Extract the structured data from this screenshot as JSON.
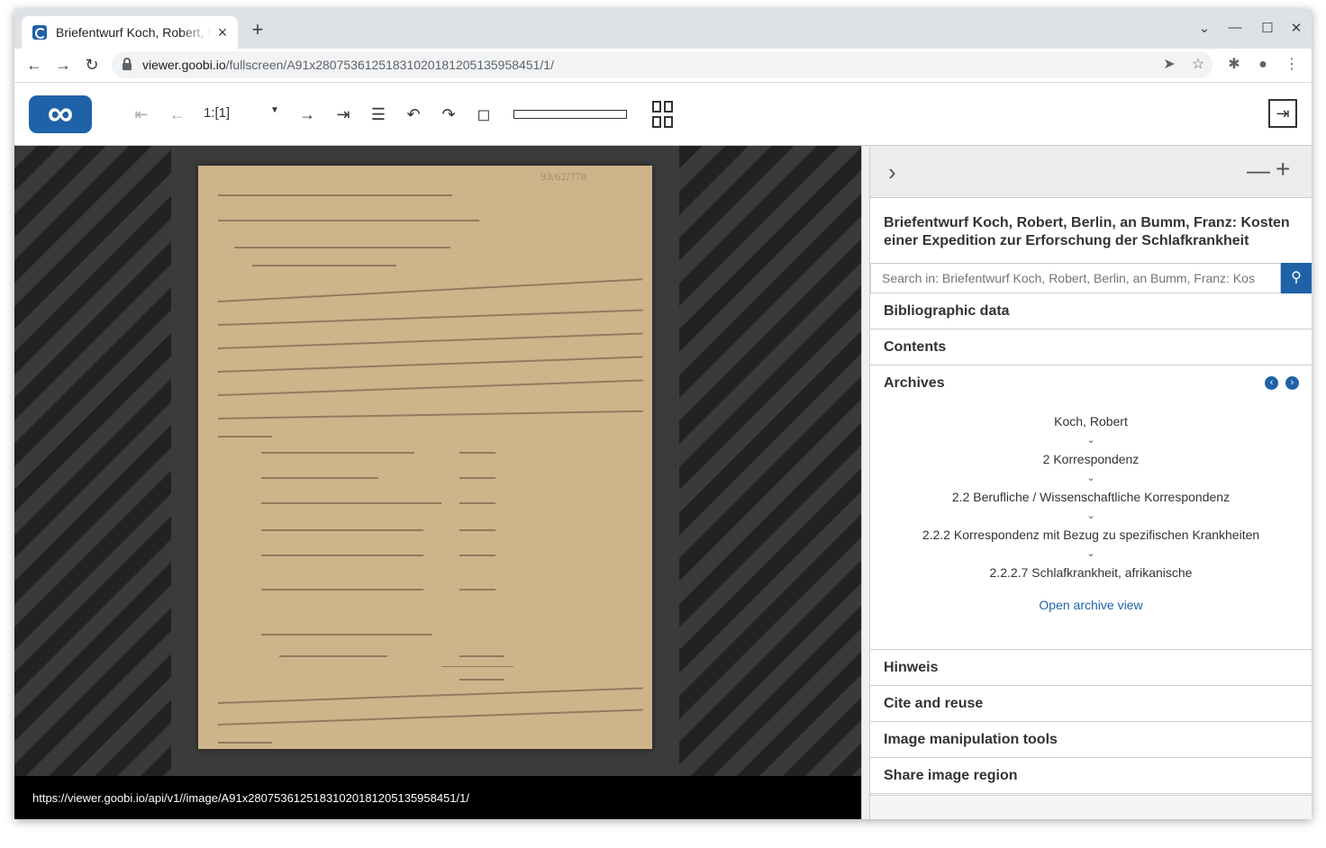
{
  "browser": {
    "tab_title": "Briefentwurf Koch, Robert, Berlin, an Bumm, Franz: Kosten einer Expedition zur Erforschung der Schlafkrankheit",
    "tab_close": "×",
    "new_tab": "+",
    "url_host": "viewer.goobi.io",
    "url_path": "/fullscreen/A91x280753612518310201812051359584​51/1/",
    "back": "←",
    "forward": "→",
    "reload": "↻",
    "send": "➤",
    "star": "☆",
    "extensions": "✱",
    "profile": "●",
    "menu": "⋮",
    "win_down": "⌄",
    "win_min": "—",
    "win_max": "☐",
    "win_close": "✕"
  },
  "viewer": {
    "logo": "∞",
    "first_page": "⇤",
    "prev_page": "←",
    "page_value": "1:[1]",
    "page_caret": "▼",
    "next_page": "→",
    "last_page": "⇥",
    "single_page": "☰",
    "rotate_left": "↶",
    "rotate_right": "↷",
    "reset": "◻",
    "exit": "⇥",
    "image_url": "https://viewer.goobi.io/api/v1//image/A91x28075361251831020181205135958451/1/",
    "stamp": "93/62/778"
  },
  "sidebar": {
    "collapse": "›",
    "minus": "—",
    "plus": "+",
    "title": "Briefentwurf Koch, Robert, Berlin, an Bumm, Franz: Kosten einer Expedition zur Erforschung der Schlafkrankheit",
    "search_placeholder": "Search in: Briefentwurf Koch, Robert, Berlin, an Bumm, Franz: Kos",
    "search_icon": "⚲",
    "sections": {
      "bibliographic": "Bibliographic data",
      "contents": "Contents",
      "archives": "Archives",
      "hinweis": "Hinweis",
      "cite": "Cite and reuse",
      "image_tools": "Image manipulation tools",
      "share": "Share image region"
    },
    "archive_prev": "‹",
    "archive_next": "›",
    "tree": [
      "Koch, Robert",
      "2 Korrespondenz",
      "2.2 Berufliche / Wissenschaftliche Korrespondenz",
      "2.2.2 Korrespondenz mit Bezug zu spezifischen Krankheiten",
      "2.2.2.7 Schlafkrankheit, afrikanische"
    ],
    "tree_caret": "⌄",
    "open_archive": "Open archive view"
  },
  "colors": {
    "accent": "#1f62a8"
  }
}
